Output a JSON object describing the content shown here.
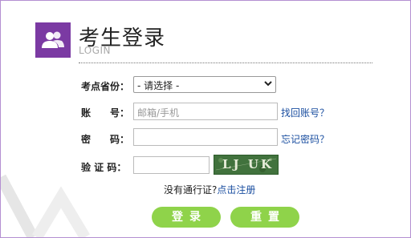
{
  "header": {
    "title": "考生登录",
    "subtitle": "LOGIN",
    "logo_icon": "users-icon",
    "accent_color": "#7b3aa3"
  },
  "form": {
    "province": {
      "label": "考点省份：",
      "selected": "- 请选择 -"
    },
    "account": {
      "label": "账　　号：",
      "placeholder": "邮箱/手机",
      "link": "找回账号？"
    },
    "password": {
      "label": "密　　码：",
      "link": "忘记密码？"
    },
    "captcha": {
      "label": "验 证 码：",
      "image_text": "LJ UK"
    },
    "register_prefix": "没有通行证?",
    "register_link": "点击注册"
  },
  "buttons": {
    "login": "登录",
    "reset": "重置",
    "color": "#8fd34a"
  }
}
